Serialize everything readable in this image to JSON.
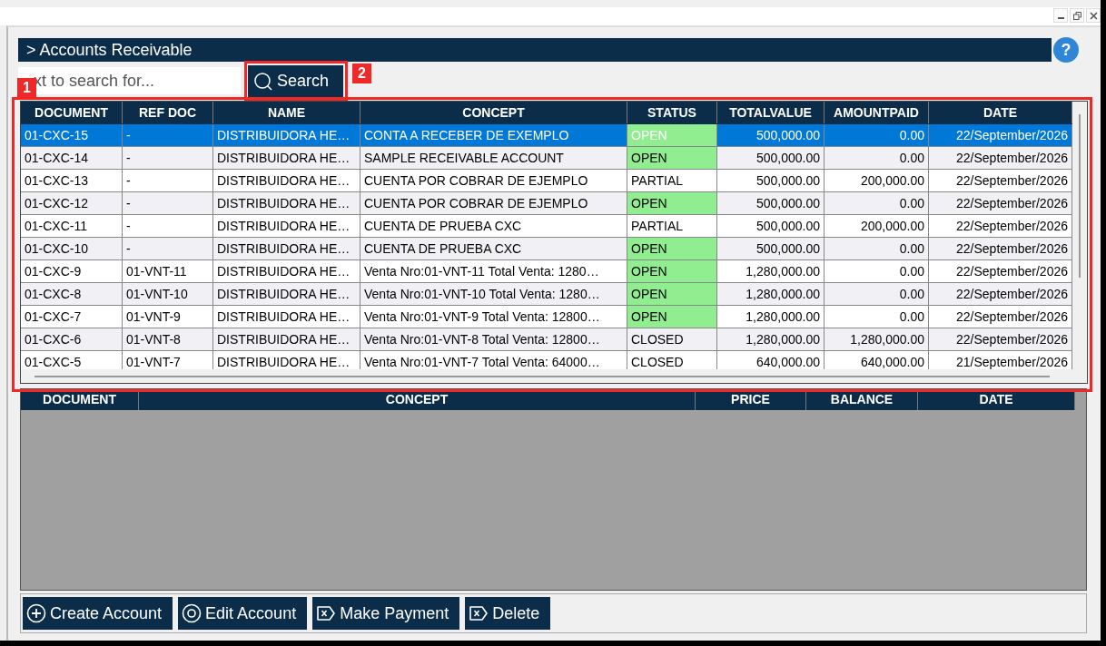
{
  "header": {
    "title": "> Accounts Receivable",
    "help": "?"
  },
  "search": {
    "placeholder": "xt to search for...",
    "button": "Search"
  },
  "annotations": [
    {
      "label": "1"
    },
    {
      "label": "2"
    }
  ],
  "grid": {
    "columns": [
      "DOCUMENT",
      "REF DOC",
      "NAME",
      "CONCEPT",
      "STATUS",
      "TOTALVALUE",
      "AMOUNTPAID",
      "DATE"
    ],
    "rows": [
      {
        "selected": true,
        "status_highlighted": true,
        "cells": [
          "01-CXC-15",
          "-",
          "DISTRIBUIDORA HE…",
          "CONTA A RECEBER DE EXEMPLO",
          "OPEN",
          "500,000.00",
          "0.00",
          "22/September/2026"
        ]
      },
      {
        "selected": false,
        "status_highlighted": true,
        "cells": [
          "01-CXC-14",
          "-",
          "DISTRIBUIDORA HE…",
          "SAMPLE RECEIVABLE ACCOUNT",
          "OPEN",
          "500,000.00",
          "0.00",
          "22/September/2026"
        ]
      },
      {
        "selected": false,
        "status_highlighted": false,
        "cells": [
          "01-CXC-13",
          "-",
          "DISTRIBUIDORA HE…",
          "CUENTA POR COBRAR DE EJEMPLO",
          "PARTIAL",
          "500,000.00",
          "200,000.00",
          "22/September/2026"
        ]
      },
      {
        "selected": false,
        "status_highlighted": true,
        "cells": [
          "01-CXC-12",
          "-",
          "DISTRIBUIDORA HE…",
          "CUENTA POR COBRAR DE EJEMPLO",
          "OPEN",
          "500,000.00",
          "0.00",
          "22/September/2026"
        ]
      },
      {
        "selected": false,
        "status_highlighted": false,
        "cells": [
          "01-CXC-11",
          "-",
          "DISTRIBUIDORA HE…",
          "CUENTA DE PRUEBA CXC",
          "PARTIAL",
          "500,000.00",
          "200,000.00",
          "22/September/2026"
        ]
      },
      {
        "selected": false,
        "status_highlighted": true,
        "cells": [
          "01-CXC-10",
          "-",
          "DISTRIBUIDORA HE…",
          "CUENTA DE PRUEBA CXC",
          "OPEN",
          "500,000.00",
          "0.00",
          "22/September/2026"
        ]
      },
      {
        "selected": false,
        "status_highlighted": true,
        "cells": [
          "01-CXC-9",
          "01-VNT-11",
          "DISTRIBUIDORA HE…",
          "Venta Nro:01-VNT-11 Total Venta: 1280…",
          "OPEN",
          "1,280,000.00",
          "0.00",
          "22/September/2026"
        ]
      },
      {
        "selected": false,
        "status_highlighted": true,
        "cells": [
          "01-CXC-8",
          "01-VNT-10",
          "DISTRIBUIDORA HE…",
          "Venta Nro:01-VNT-10 Total Venta: 1280…",
          "OPEN",
          "1,280,000.00",
          "0.00",
          "22/September/2026"
        ]
      },
      {
        "selected": false,
        "status_highlighted": true,
        "cells": [
          "01-CXC-7",
          "01-VNT-9",
          "DISTRIBUIDORA HE…",
          "Venta Nro:01-VNT-9 Total Venta: 12800…",
          "OPEN",
          "1,280,000.00",
          "0.00",
          "22/September/2026"
        ]
      },
      {
        "selected": false,
        "status_highlighted": false,
        "cells": [
          "01-CXC-6",
          "01-VNT-8",
          "DISTRIBUIDORA HE…",
          "Venta Nro:01-VNT-8 Total Venta: 12800…",
          "CLOSED",
          "1,280,000.00",
          "1,280,000.00",
          "22/September/2026"
        ]
      },
      {
        "selected": false,
        "status_highlighted": false,
        "cells": [
          "01-CXC-5",
          "01-VNT-7",
          "DISTRIBUIDORA HE…",
          "Venta Nro:01-VNT-7 Total Venta: 64000…",
          "CLOSED",
          "640,000.00",
          "640,000.00",
          "21/September/2026"
        ]
      }
    ]
  },
  "detail": {
    "columns": [
      "DOCUMENT",
      "CONCEPT",
      "PRICE",
      "BALANCE",
      "DATE"
    ]
  },
  "buttons": [
    {
      "label": "Create Account",
      "kind": "create"
    },
    {
      "label": "Edit Account",
      "kind": "edit"
    },
    {
      "label": "Make Payment",
      "kind": "pay"
    },
    {
      "label": "Delete",
      "kind": "delete"
    }
  ]
}
